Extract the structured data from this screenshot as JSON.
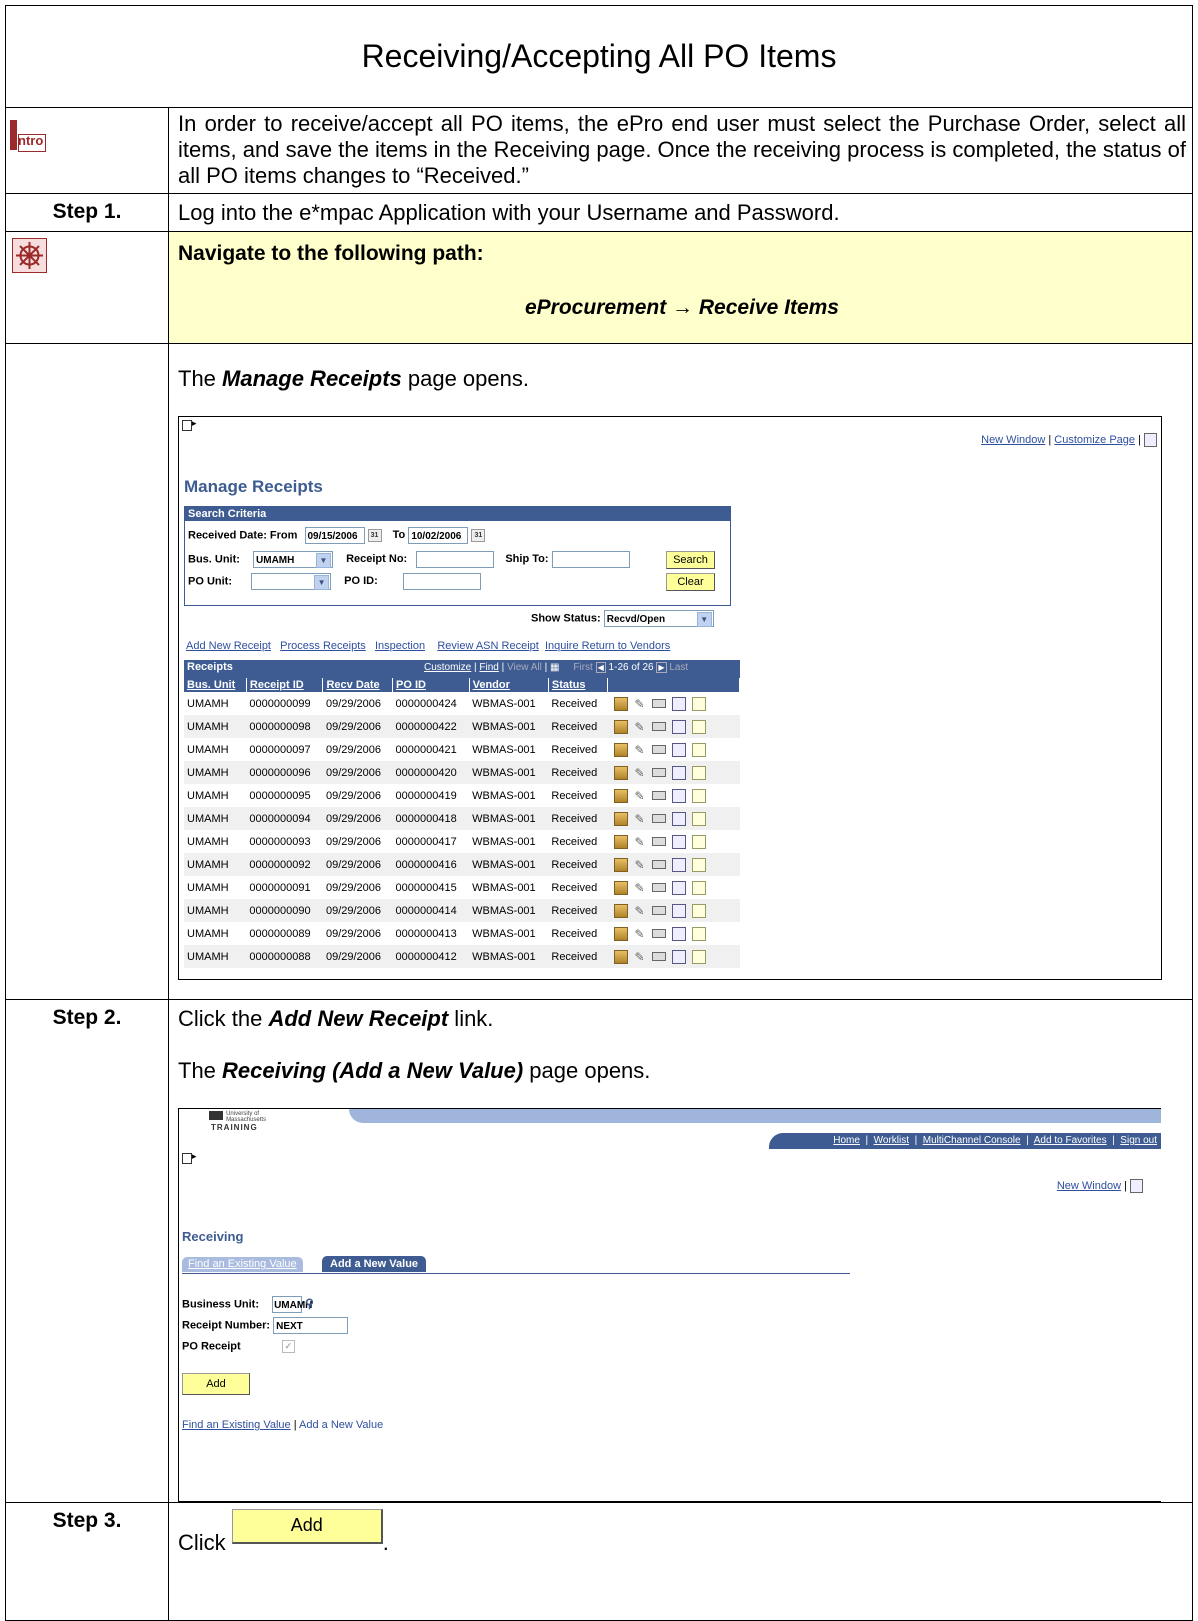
{
  "title": "Receiving/Accepting All PO Items",
  "intro": {
    "icon_text": "ntro",
    "text": "In order to receive/accept all PO items, the ePro end user must select the Purchase Order, select all items, and save the items in the Receiving page.  Once the receiving process is completed, the status of all PO items changes to “Received.”"
  },
  "step1": {
    "label": "Step 1.",
    "text": "Log into the e*mpac Application with your Username and Password."
  },
  "navigate": {
    "heading": "Navigate to the following path:",
    "path": "eProcurement → Receive Items"
  },
  "manage_intro": {
    "prefix": "The ",
    "bold": "Manage Receipts",
    "suffix": " page opens."
  },
  "manage": {
    "links": {
      "new_window": "New Window",
      "customize_page": "Customize Page",
      "sep": "|"
    },
    "title": "Manage Receipts",
    "search_header": "Search Criteria",
    "received_from_label": "Received Date: From",
    "from_value": "09/15/2006",
    "to_label": "To",
    "to_value": "10/02/2006",
    "bus_unit_label": "Bus. Unit:",
    "bus_unit_value": "UMAMH",
    "receipt_no_label": "Receipt No:",
    "ship_to_label": "Ship To:",
    "po_unit_label": "PO Unit:",
    "po_id_label": "PO ID:",
    "search_btn": "Search",
    "clear_btn": "Clear",
    "show_status_label": "Show Status:",
    "show_status_value": "Recvd/Open",
    "action_links": [
      "Add New Receipt",
      "Process Receipts",
      "Inspection",
      "Review ASN Receipt",
      "Inquire Return to Vendors"
    ],
    "grid_title": "Receipts",
    "grid_nav": {
      "customize": "Customize",
      "find": "Find",
      "view_all": "View All",
      "first": "First",
      "range": "1-26 of 26",
      "last": "Last"
    },
    "columns": [
      "Bus. Unit",
      "Receipt ID",
      "Recv Date",
      "PO ID",
      "Vendor",
      "Status"
    ],
    "rows": [
      [
        "UMAMH",
        "0000000099",
        "09/29/2006",
        "0000000424",
        "WBMAS-001",
        "Received"
      ],
      [
        "UMAMH",
        "0000000098",
        "09/29/2006",
        "0000000422",
        "WBMAS-001",
        "Received"
      ],
      [
        "UMAMH",
        "0000000097",
        "09/29/2006",
        "0000000421",
        "WBMAS-001",
        "Received"
      ],
      [
        "UMAMH",
        "0000000096",
        "09/29/2006",
        "0000000420",
        "WBMAS-001",
        "Received"
      ],
      [
        "UMAMH",
        "0000000095",
        "09/29/2006",
        "0000000419",
        "WBMAS-001",
        "Received"
      ],
      [
        "UMAMH",
        "0000000094",
        "09/29/2006",
        "0000000418",
        "WBMAS-001",
        "Received"
      ],
      [
        "UMAMH",
        "0000000093",
        "09/29/2006",
        "0000000417",
        "WBMAS-001",
        "Received"
      ],
      [
        "UMAMH",
        "0000000092",
        "09/29/2006",
        "0000000416",
        "WBMAS-001",
        "Received"
      ],
      [
        "UMAMH",
        "0000000091",
        "09/29/2006",
        "0000000415",
        "WBMAS-001",
        "Received"
      ],
      [
        "UMAMH",
        "0000000090",
        "09/29/2006",
        "0000000414",
        "WBMAS-001",
        "Received"
      ],
      [
        "UMAMH",
        "0000000089",
        "09/29/2006",
        "0000000413",
        "WBMAS-001",
        "Received"
      ],
      [
        "UMAMH",
        "0000000088",
        "09/29/2006",
        "0000000412",
        "WBMAS-001",
        "Received"
      ]
    ]
  },
  "step2": {
    "label": "Step 2.",
    "line1": {
      "prefix": "Click the ",
      "bold": "Add New Receipt",
      "suffix": " link."
    },
    "line2": {
      "prefix": "The ",
      "bold": "Receiving (Add a New Value)",
      "suffix": " page opens."
    }
  },
  "receiving": {
    "logo_line1": "University of",
    "logo_line2": "Massachusetts",
    "logo_sub": "TRAINING",
    "top_links": [
      "Home",
      "Worklist",
      "MultiChannel Console",
      "Add to Favorites",
      "Sign out"
    ],
    "new_window": "New Window",
    "title": "Receiving",
    "tabs": [
      "Find an Existing Value",
      "Add a New Value"
    ],
    "business_unit_label": "Business Unit:",
    "business_unit_value": "UMAMH",
    "receipt_number_label": "Receipt Number:",
    "receipt_number_value": "NEXT",
    "po_receipt_label": "PO Receipt",
    "add_btn": "Add",
    "bottom_links": [
      "Find an Existing Value",
      "Add a New Value"
    ]
  },
  "step3": {
    "label": "Step 3.",
    "prefix": "Click ",
    "button": "Add",
    "suffix": "."
  }
}
